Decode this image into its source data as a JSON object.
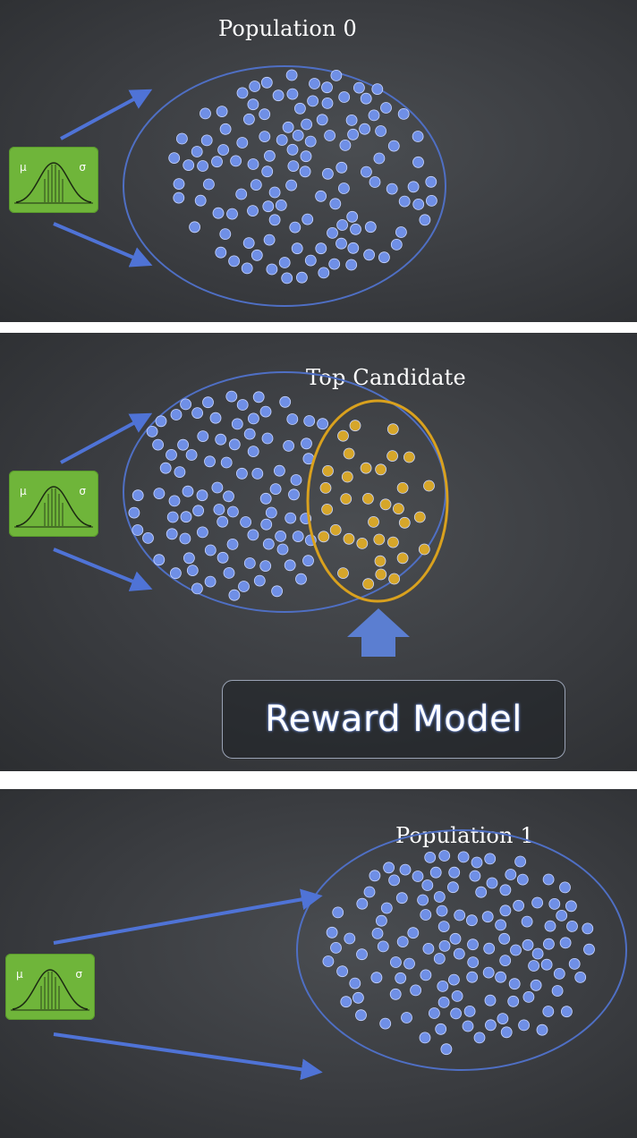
{
  "panels": [
    {
      "title": "Population 0"
    },
    {
      "title": "Top Candidate",
      "reward_model_label": "Reward Model"
    },
    {
      "title": "Population 1"
    }
  ],
  "gaussian_icon": {
    "mu_symbol": "μ",
    "sigma_symbol": "σ"
  },
  "colors": {
    "point_blue": "#6f8fe6",
    "point_gold": "#d6a62a",
    "ellipse_blue": "#4f6fc4",
    "ellipse_gold": "#d9a11e",
    "arrow_blue": "#4f73d6",
    "gaussian_green": "#6fb53a"
  }
}
